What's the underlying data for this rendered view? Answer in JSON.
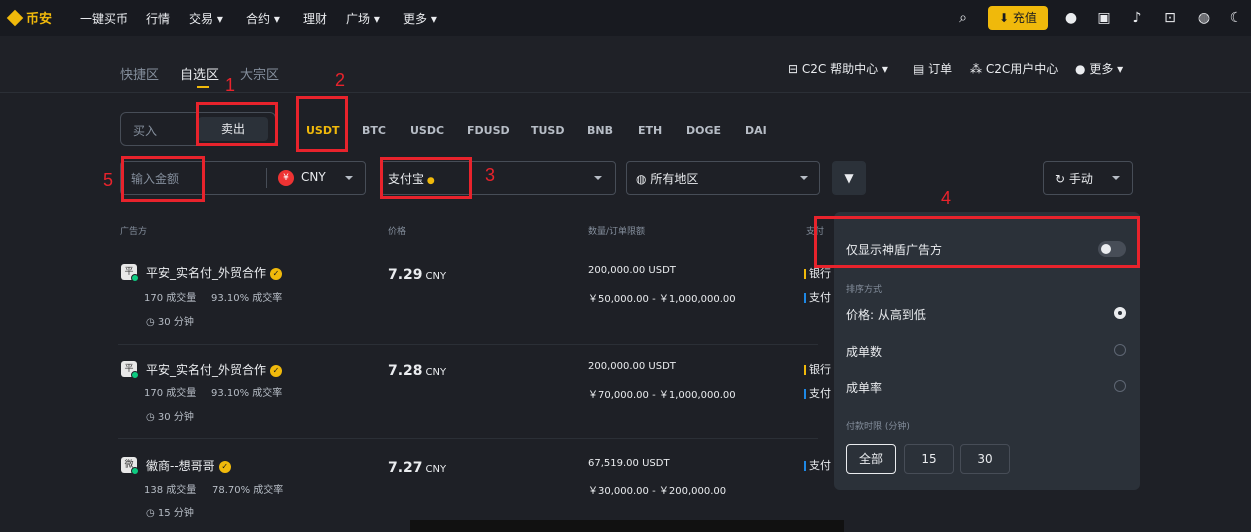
{
  "nav": {
    "brand": "币安",
    "items": [
      "一键买币",
      "行情",
      "交易",
      "合约",
      "理财",
      "广场",
      "更多"
    ],
    "recharge": "充值"
  },
  "subnav": {
    "tabs": [
      "快捷区",
      "自选区",
      "大宗区"
    ],
    "right_links": [
      "C2C 帮助中心",
      "订单",
      "C2C用户中心",
      "更多"
    ]
  },
  "trade": {
    "buy": "买入",
    "sell": "卖出",
    "coins": [
      "USDT",
      "BTC",
      "USDC",
      "FDUSD",
      "TUSD",
      "BNB",
      "ETH",
      "DOGE",
      "DAI"
    ]
  },
  "filters": {
    "amount_placeholder": "输入金额",
    "currency_symbol": "¥",
    "currency": "CNY",
    "payment": "支付宝",
    "region": "所有地区",
    "refresh": "手动"
  },
  "table": {
    "headers": [
      "广告方",
      "价格",
      "数量/订单限额",
      "支付"
    ],
    "rows": [
      {
        "avatar": "平",
        "name": "平安_实名付_外贸合作",
        "trades": "170 成交量",
        "rate": "93.10% 成交率",
        "time": "30 分钟",
        "price": "7.29",
        "price_unit": "CNY",
        "qty": "200,000.00 USDT",
        "limit": "￥50,000.00 - ￥1,000,000.00",
        "pay1": "银行",
        "pay2": "支付"
      },
      {
        "avatar": "平",
        "name": "平安_实名付_外贸合作",
        "trades": "170 成交量",
        "rate": "93.10% 成交率",
        "time": "30 分钟",
        "price": "7.28",
        "price_unit": "CNY",
        "qty": "200,000.00 USDT",
        "limit": "￥70,000.00 - ￥1,000,000.00",
        "pay1": "银行",
        "pay2": "支付"
      },
      {
        "avatar": "微",
        "name": "徽商--想哥哥",
        "trades": "138 成交量",
        "rate": "78.70% 成交率",
        "time": "15 分钟",
        "price": "7.27",
        "price_unit": "CNY",
        "qty": "67,519.00 USDT",
        "limit": "￥30,000.00 - ￥200,000.00",
        "pay1": "支付",
        "pay2": ""
      }
    ]
  },
  "panel": {
    "show_only": "仅显示神盾广告方",
    "sort_label": "排序方式",
    "sort_options": [
      "价格: 从高到低",
      "成单数",
      "成单率"
    ],
    "time_label": "付款时限 (分钟)",
    "time_options": [
      "全部",
      "15",
      "30"
    ]
  },
  "annotations": [
    "1",
    "2",
    "3",
    "4",
    "5"
  ],
  "colors": {
    "accent": "#f0b90b",
    "annotation": "#e8232c",
    "bg": "#181a20"
  }
}
